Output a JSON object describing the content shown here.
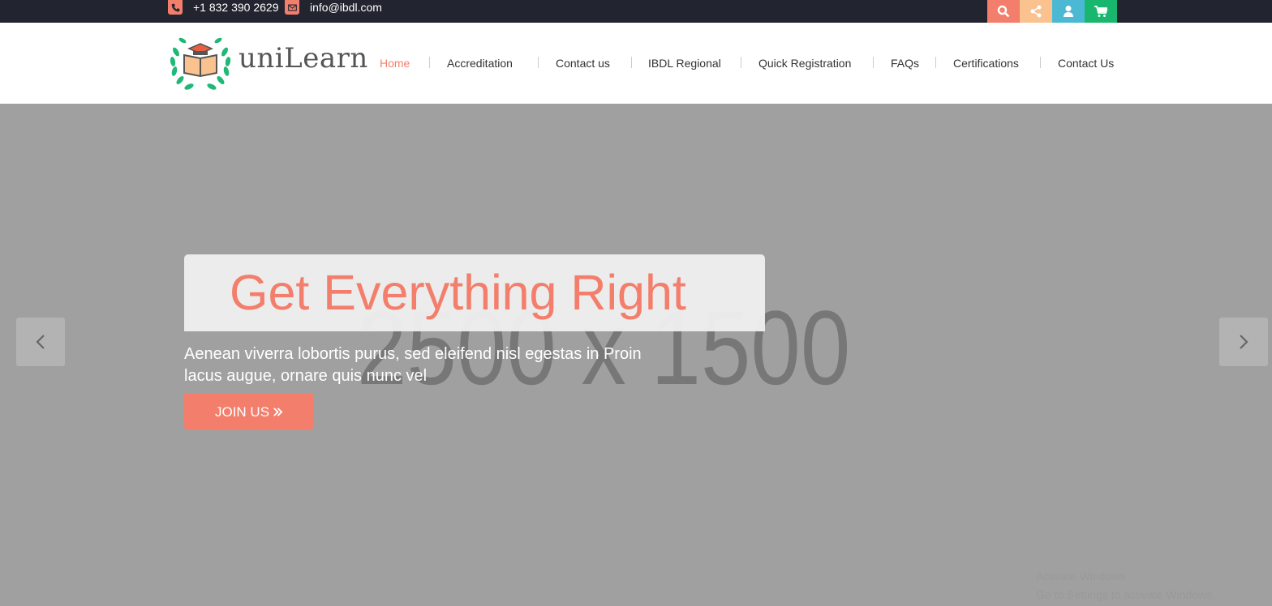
{
  "topbar": {
    "phone": "+1 832 390 2629",
    "email": "info@ibdl.com",
    "icons": [
      "phone-icon",
      "envelope-icon"
    ],
    "quick_buttons": [
      {
        "name": "search-button",
        "icon": "search-icon",
        "color": "#f37e6b"
      },
      {
        "name": "share-button",
        "icon": "share-icon",
        "color": "#f9c28e"
      },
      {
        "name": "account-button",
        "icon": "user-icon",
        "color": "#4bb9d3"
      },
      {
        "name": "cart-button",
        "icon": "cart-icon",
        "color": "#19b76e"
      }
    ]
  },
  "header": {
    "brand": "uniLearn",
    "logo_icon": "laurel-book-logo",
    "nav": [
      "Home",
      "Accreditation",
      "Contact us",
      "IBDL Regional",
      "Quick Registration",
      "FAQs",
      "Certifications",
      "Contact Us"
    ],
    "active_nav": "Home"
  },
  "hero": {
    "placeholder": "2500 x 1500",
    "title": "Get Everything Right",
    "subtitle": "Aenean viverra lobortis purus, sed eleifend nisl egestas in Proin lacus augue, ornare quis nunc vel",
    "button": "JOIN US",
    "button_icon": "double-chevron-right-icon",
    "prev_icon": "chevron-left-icon",
    "next_icon": "chevron-right-icon"
  },
  "watermark": {
    "line1": "Activate Windows",
    "line2": "Go to Settings to activate Windows."
  },
  "colors": {
    "accent": "#f37e6b",
    "topbar": "#22252f",
    "hero_bg": "#a0a0a0"
  }
}
